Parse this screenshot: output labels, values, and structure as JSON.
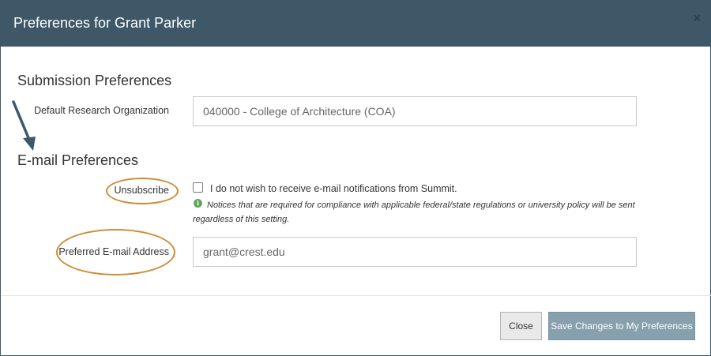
{
  "dialog": {
    "title": "Preferences for Grant Parker",
    "close_glyph": "×"
  },
  "submission": {
    "heading": "Submission Preferences",
    "org_label": "Default Research Organization",
    "org_value": "040000 - College of Architecture (COA)"
  },
  "email": {
    "heading": "E-mail Preferences",
    "unsubscribe_label": "Unsubscribe",
    "unsubscribe_checked": false,
    "unsubscribe_text": "I do not wish to receive e-mail notifications from Summit.",
    "notice_text": "Notices that are required for compliance with applicable federal/state regulations or university policy will be sent regardless of this setting.",
    "preferred_label": "Preferred E-mail Address",
    "preferred_value": "grant@crest.edu"
  },
  "footer": {
    "close_label": "Close",
    "save_label": "Save Changes to My Preferences"
  },
  "annotations": {
    "highlight_color": "#d08a37",
    "arrow_color": "#3e5868"
  },
  "colors": {
    "header_bg": "#3e5868",
    "primary_button": "#86a0ae",
    "info_icon": "#5fa55a"
  }
}
